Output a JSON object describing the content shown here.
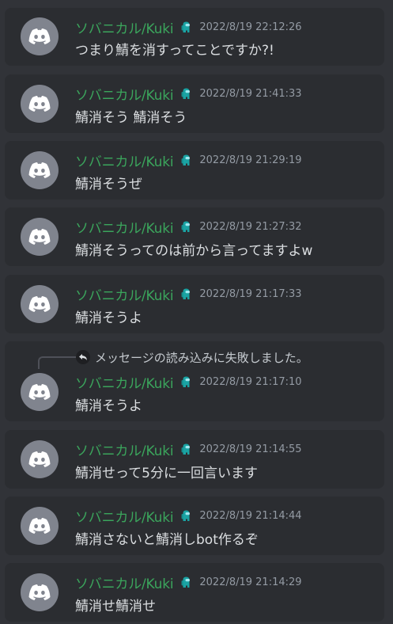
{
  "colors": {
    "background": "#313338",
    "card": "#2b2d31",
    "username": "#3ba55c",
    "badge": "#1aa3a3",
    "timestamp": "#949ba4",
    "text": "#dbdee1",
    "avatar": "#80848e"
  },
  "icons": {
    "avatar": "discord-logo-icon",
    "badge": "among-us-crewmate-icon",
    "reply": "reply-arrow-icon"
  },
  "messages": [
    {
      "username": "ソバニカル/Kuki",
      "timestamp": "2022/8/19 22:12:26",
      "content": "つまり鯖を消すってことですか?!"
    },
    {
      "username": "ソバニカル/Kuki",
      "timestamp": "2022/8/19 21:41:33",
      "content": "鯖消そう 鯖消そう"
    },
    {
      "username": "ソバニカル/Kuki",
      "timestamp": "2022/8/19 21:29:19",
      "content": "鯖消そうぜ"
    },
    {
      "username": "ソバニカル/Kuki",
      "timestamp": "2022/8/19 21:27:32",
      "content": "鯖消そうってのは前から言ってますよw"
    },
    {
      "username": "ソバニカル/Kuki",
      "timestamp": "2022/8/19 21:17:33",
      "content": "鯖消そうよ"
    },
    {
      "reply_text": "メッセージの読み込みに失敗しました。",
      "username": "ソバニカル/Kuki",
      "timestamp": "2022/8/19 21:17:10",
      "content": "鯖消そうよ"
    },
    {
      "username": "ソバニカル/Kuki",
      "timestamp": "2022/8/19 21:14:55",
      "content": "鯖消せって5分に一回言います"
    },
    {
      "username": "ソバニカル/Kuki",
      "timestamp": "2022/8/19 21:14:44",
      "content": "鯖消さないと鯖消しbot作るぞ"
    },
    {
      "username": "ソバニカル/Kuki",
      "timestamp": "2022/8/19 21:14:29",
      "content": "鯖消せ鯖消せ"
    }
  ]
}
